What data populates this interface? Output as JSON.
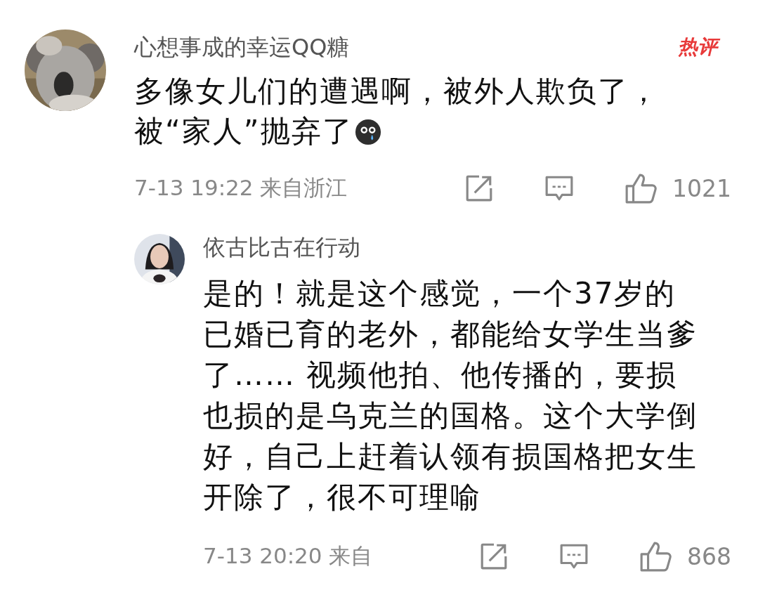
{
  "comment": {
    "username": "心想事成的幸运QQ糖",
    "badge": "热评",
    "text": "多像女儿们的遭遇啊，被外人欺负了，被“家人”抛弃了",
    "emoji_after_text": true,
    "meta": "7-13 19:22 来自浙江",
    "likes": "1021",
    "replies": [
      {
        "username": "依古比古在行动",
        "text": "是的！就是这个感觉，一个37岁的已婚已育的老外，都能给女学生当爹了…… 视频他拍、他传播的，要损也损的是乌克兰的国格。这个大学倒好，自己上赶着认领有损国格把女生开除了，很不可理喻",
        "emoji_after_text": false,
        "meta": "7-13 20:20 来自",
        "likes": "868"
      }
    ]
  }
}
